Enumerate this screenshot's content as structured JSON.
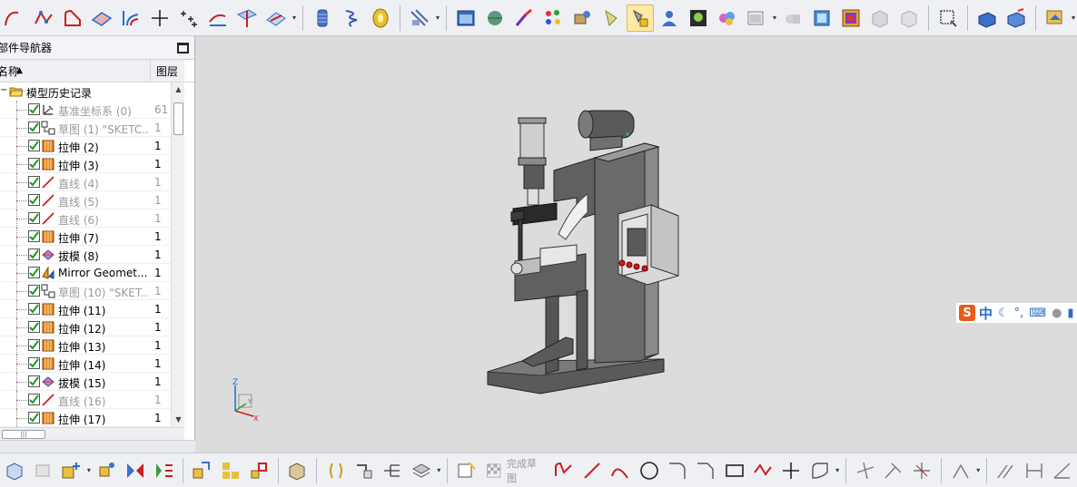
{
  "navigator": {
    "title": "部件导航器",
    "columns": {
      "name": "名称",
      "layer": "图层"
    },
    "root": {
      "label": "模型历史记录"
    },
    "rows": [
      {
        "name": "基准坐标系 (0)",
        "layer": "61",
        "icon": "datum-csys-icon",
        "dim": true
      },
      {
        "name": "草图 (1) \"SKETC...",
        "layer": "1",
        "icon": "sketch-icon",
        "dim": true
      },
      {
        "name": "拉伸 (2)",
        "layer": "1",
        "icon": "extrude-icon",
        "dim": false
      },
      {
        "name": "拉伸 (3)",
        "layer": "1",
        "icon": "extrude-icon",
        "dim": false
      },
      {
        "name": "直线 (4)",
        "layer": "1",
        "icon": "line-icon",
        "dim": true
      },
      {
        "name": "直线 (5)",
        "layer": "1",
        "icon": "line-icon",
        "dim": true
      },
      {
        "name": "直线 (6)",
        "layer": "1",
        "icon": "line-icon",
        "dim": true
      },
      {
        "name": "拉伸 (7)",
        "layer": "1",
        "icon": "extrude-icon",
        "dim": false
      },
      {
        "name": "拔模 (8)",
        "layer": "1",
        "icon": "draft-icon",
        "dim": false
      },
      {
        "name": "Mirror Geomet...",
        "layer": "1",
        "icon": "mirror-geometry-icon",
        "dim": false
      },
      {
        "name": "草图 (10) \"SKET...",
        "layer": "1",
        "icon": "sketch-icon",
        "dim": true
      },
      {
        "name": "拉伸 (11)",
        "layer": "1",
        "icon": "extrude-icon",
        "dim": false
      },
      {
        "name": "拉伸 (12)",
        "layer": "1",
        "icon": "extrude-icon",
        "dim": false
      },
      {
        "name": "拉伸 (13)",
        "layer": "1",
        "icon": "extrude-icon",
        "dim": false
      },
      {
        "name": "拉伸 (14)",
        "layer": "1",
        "icon": "extrude-icon",
        "dim": false
      },
      {
        "name": "拔模 (15)",
        "layer": "1",
        "icon": "draft-icon",
        "dim": false
      },
      {
        "name": "直线 (16)",
        "layer": "1",
        "icon": "line-icon",
        "dim": true
      },
      {
        "name": "拉伸 (17)",
        "layer": "1",
        "icon": "extrude-icon",
        "dim": false
      }
    ]
  },
  "hscroll": {
    "thumb_glyph": "|||"
  },
  "triad": {
    "z": "Z",
    "x": "X",
    "y": "Y"
  },
  "ime": {
    "logo": "S",
    "lang": "中",
    "moon": "☾",
    "punct": "°,",
    "keyboard": "⌨"
  },
  "bottom_toolbar": {
    "finish_sketch_label": "完成草图"
  },
  "colors": {
    "viewport_bg": "#dcdcdc",
    "model_body": "#6a6a6a",
    "button_red": "#d81818",
    "accent": "#2a6cc8"
  }
}
